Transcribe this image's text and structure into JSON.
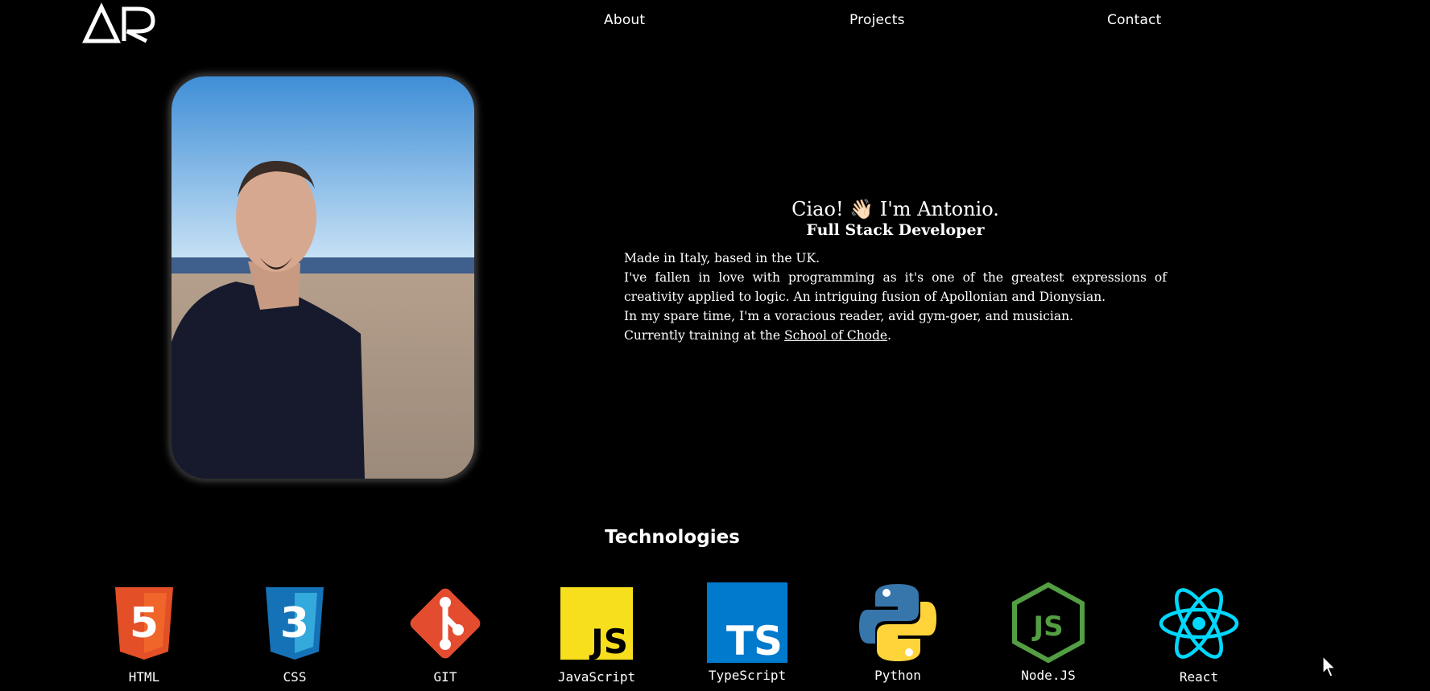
{
  "header": {
    "logo_text": "AR",
    "nav": [
      {
        "label": "About"
      },
      {
        "label": "Projects"
      },
      {
        "label": "Contact"
      }
    ]
  },
  "intro": {
    "greeting": "Ciao! 👋🏻 I'm Antonio.",
    "role": "Full Stack Developer",
    "bio_lines": [
      "Made in Italy, based in the UK.",
      "I've fallen in love with programming as it's one of the greatest expressions of creativity applied to logic. An intriguing fusion of Apollonian and Dionysian.",
      "In my spare time, I'm a voracious reader, avid gym-goer, and musician."
    ],
    "training_prefix": "Currently training at the ",
    "training_link": "School of Chode",
    "training_suffix": "."
  },
  "technologies": {
    "title": "Technologies",
    "items": [
      {
        "label": "HTML",
        "icon": "html5-icon",
        "color": "#E34F26"
      },
      {
        "label": "CSS",
        "icon": "css3-icon",
        "color": "#1572B6"
      },
      {
        "label": "GIT",
        "icon": "git-icon",
        "color": "#E44C30"
      },
      {
        "label": "JavaScript",
        "icon": "javascript-icon",
        "color": "#F7DF1E"
      },
      {
        "label": "TypeScript",
        "icon": "typescript-icon",
        "color": "#007ACC"
      },
      {
        "label": "Python",
        "icon": "python-icon",
        "color": "#3776AB"
      },
      {
        "label": "Node.JS",
        "icon": "nodejs-icon",
        "color": "#539E43"
      },
      {
        "label": "React",
        "icon": "react-icon",
        "color": "#00D8FF"
      }
    ]
  }
}
